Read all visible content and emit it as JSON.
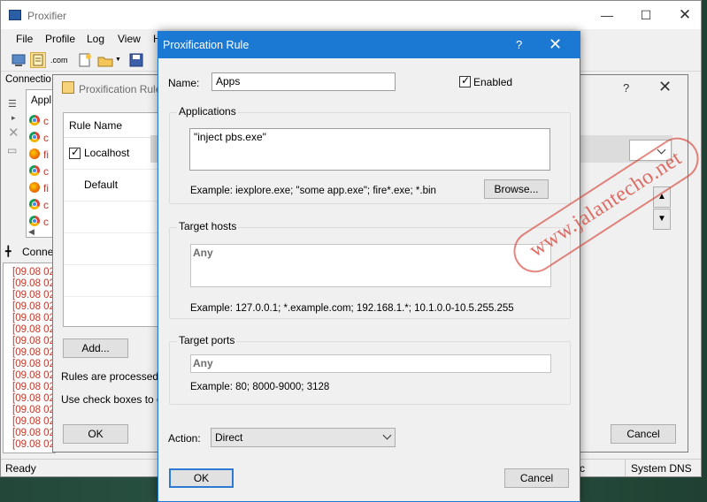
{
  "main": {
    "title": "Proxifier",
    "menu": [
      "File",
      "Profile",
      "Log",
      "View",
      "H"
    ],
    "toolbar_text_icon": ".com",
    "connections_header": "Connectio",
    "app_header": "Appl",
    "apps": [
      {
        "icon": "chrome-icon",
        "text": "c"
      },
      {
        "icon": "chrome-icon",
        "text": "c"
      },
      {
        "icon": "firefox-icon",
        "text": "fi"
      },
      {
        "icon": "chrome-icon",
        "text": "c"
      },
      {
        "icon": "firefox-icon",
        "text": "fi"
      },
      {
        "icon": "chrome-icon",
        "text": "c"
      },
      {
        "icon": "chrome-icon",
        "text": "c"
      }
    ],
    "log_tab": "Conne",
    "log_lines": [
      "[09.08 02",
      "[09.08 02",
      "[09.08 02",
      "[09.08 02",
      "[09.08 02",
      "[09.08 02",
      "[09.08 02",
      "[09.08 02",
      "[09.08 02",
      "[09.08 02",
      "[09.08 02",
      "[09.08 02",
      "[09.08 02",
      "[09.08 02",
      "[09.08 02",
      "[09.08 02"
    ],
    "status_ready": "Ready",
    "status_c": "c",
    "status_dns": "System DNS"
  },
  "rules_dialog": {
    "title": "Proxification Rule",
    "help": "?",
    "column_header": "Rule Name",
    "rules": [
      {
        "name": "Localhost",
        "checked": true
      },
      {
        "name": "Default",
        "checked": false
      }
    ],
    "add_button": "Add...",
    "info_line1": "Rules are processed fr",
    "info_line2": "Use check boxes to en",
    "ok_button": "OK",
    "cancel_button": "Cancel"
  },
  "rule_dialog": {
    "title": "Proxification Rule",
    "help": "?",
    "name_label": "Name:",
    "name_value": "Apps",
    "enabled_label": "Enabled",
    "enabled": true,
    "applications": {
      "title": "Applications",
      "value": "\"inject pbs.exe\"",
      "example": "Example: iexplore.exe; \"some app.exe\"; fire*.exe; *.bin",
      "browse_button": "Browse..."
    },
    "target_hosts": {
      "title": "Target hosts",
      "value": "Any",
      "example": "Example: 127.0.0.1; *.example.com; 192.168.1.*; 10.1.0.0-10.5.255.255"
    },
    "target_ports": {
      "title": "Target ports",
      "value": "Any",
      "example": "Example: 80; 8000-9000; 3128"
    },
    "action_label": "Action:",
    "action_value": "Direct",
    "ok_button": "OK",
    "cancel_button": "Cancel"
  },
  "watermark": "www.jalantecho.net",
  "colors": {
    "title_blue": "#1c79d3",
    "log_red": "#c0392b",
    "watermark_red": "#d6463c"
  }
}
